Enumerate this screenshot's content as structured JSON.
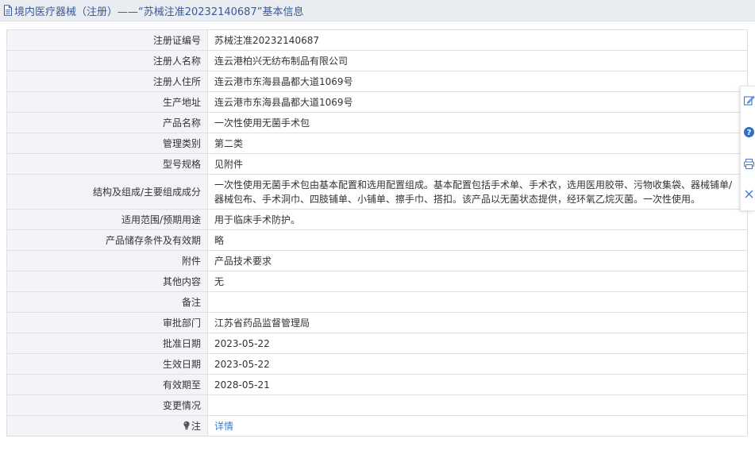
{
  "page": {
    "title": "境内医疗器械（注册）——“苏械注准20232140687”基本信息"
  },
  "table": {
    "rows": [
      {
        "label": "注册证编号",
        "value": "苏械注准20232140687"
      },
      {
        "label": "注册人名称",
        "value": "连云港柏兴无纺布制品有限公司"
      },
      {
        "label": "注册人住所",
        "value": "连云港市东海县晶都大道1069号"
      },
      {
        "label": "生产地址",
        "value": "连云港市东海县晶都大道1069号"
      },
      {
        "label": "产品名称",
        "value": "一次性使用无菌手术包"
      },
      {
        "label": "管理类别",
        "value": "第二类"
      },
      {
        "label": "型号规格",
        "value": "见附件"
      },
      {
        "label": "结构及组成/主要组成成分",
        "value": "一次性使用无菌手术包由基本配置和选用配置组成。基本配置包括手术单、手术衣，选用医用胶带、污物收集袋、器械铺单/器械包布、手术洞巾、四肢铺单、小铺单、擦手巾、搭扣。该产品以无菌状态提供，经环氧乙烷灭菌。一次性使用。"
      },
      {
        "label": "适用范围/预期用途",
        "value": "用于临床手术防护。"
      },
      {
        "label": "产品储存条件及有效期",
        "value": "略"
      },
      {
        "label": "附件",
        "value": "产品技术要求"
      },
      {
        "label": "其他内容",
        "value": "无"
      },
      {
        "label": "备注",
        "value": ""
      },
      {
        "label": "审批部门",
        "value": "江苏省药品监督管理局"
      },
      {
        "label": "批准日期",
        "value": "2023-05-22"
      },
      {
        "label": "生效日期",
        "value": "2023-05-22"
      },
      {
        "label": "有效期至",
        "value": "2028-05-21"
      },
      {
        "label": "变更情况",
        "value": ""
      }
    ],
    "note": {
      "label": "注",
      "link_text": "详情",
      "icon": "lightbulb-icon"
    }
  },
  "side_toolbar": {
    "icons": [
      "edit-icon",
      "help-icon",
      "print-icon",
      "close-icon"
    ],
    "accent": "#3a7bd5"
  },
  "colors": {
    "title_text": "#3a5a96",
    "title_bg": "#e9ecf1",
    "label_bg": "#f3f4f7",
    "border": "#dcdfe4",
    "link": "#3a7bd5"
  }
}
